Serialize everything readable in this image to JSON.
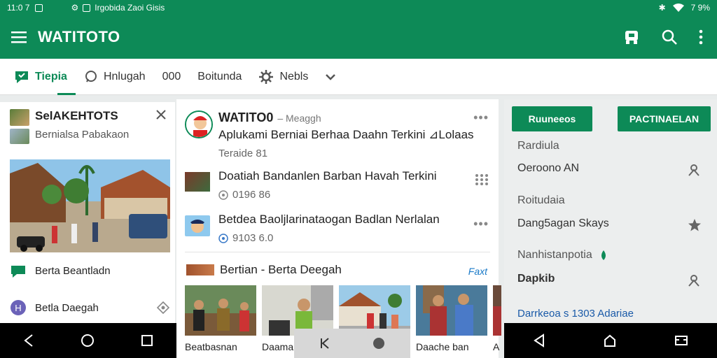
{
  "statusbar": {
    "time": "11:0 7",
    "notification_text": "Irgobida Zaoi Gisis",
    "battery": "7 9%"
  },
  "appbar": {
    "title": "WATITOTO"
  },
  "tabs": [
    {
      "label": "Tiepia",
      "icon": "tag-icon",
      "active": true
    },
    {
      "label": "Hnlugah",
      "icon": "chat-icon",
      "active": false
    },
    {
      "label": "000",
      "icon": "",
      "active": false
    },
    {
      "label": "Boitunda",
      "icon": "",
      "active": false
    },
    {
      "label": "Nebls",
      "icon": "gear-icon",
      "active": false
    }
  ],
  "left_card": {
    "title": "SelAKEHTOTS",
    "subtitle": "Bernialsa Pabakaon",
    "rows": [
      {
        "label": "Berta Beantladn",
        "icon": "chat-bubble-icon"
      },
      {
        "label": "Betla Daegah",
        "icon": "h-badge-icon"
      }
    ]
  },
  "center_card": {
    "posts": [
      {
        "author": "WATITO0",
        "meta": "– Meaggh",
        "headline": "Aplukami Berniai Berhaa Daahn Terkini ⊿Lolaas",
        "stats": "Teraide  81"
      },
      {
        "headline": "Doatiah Bandanlen Barban Havah Terkini",
        "stats": "0196   86"
      },
      {
        "headline": "Betdea Baoljlarinataogan Badlan Nerlalan",
        "stats": "9103   6.0"
      }
    ],
    "section_title": "Bertian - Berta Deegah",
    "section_link": "Faxt",
    "captions": [
      "Beatbasnan",
      "Daaman",
      "",
      "Daache ban",
      "A"
    ]
  },
  "right_panel": {
    "button_left": "Ruuneeos",
    "button_right": "PACTINAELAN",
    "items": [
      {
        "text": "Rardiula",
        "kind": "label"
      },
      {
        "text": "Oeroono AN",
        "kind": "item",
        "icon": "person-icon"
      },
      {
        "text": "Roitudaia",
        "kind": "label"
      },
      {
        "text": "Dang5agan Skays",
        "kind": "item",
        "icon": "star-icon"
      },
      {
        "text": "Nanhistanpotia",
        "kind": "label",
        "icon": "green-drop-icon"
      },
      {
        "text": "Dapkib",
        "kind": "item",
        "icon": "person-icon"
      },
      {
        "text": "Darrkeoa s 1303 Adariae",
        "kind": "link"
      }
    ]
  },
  "colors": {
    "brand": "#0d8a57",
    "link": "#1a5aa8"
  }
}
